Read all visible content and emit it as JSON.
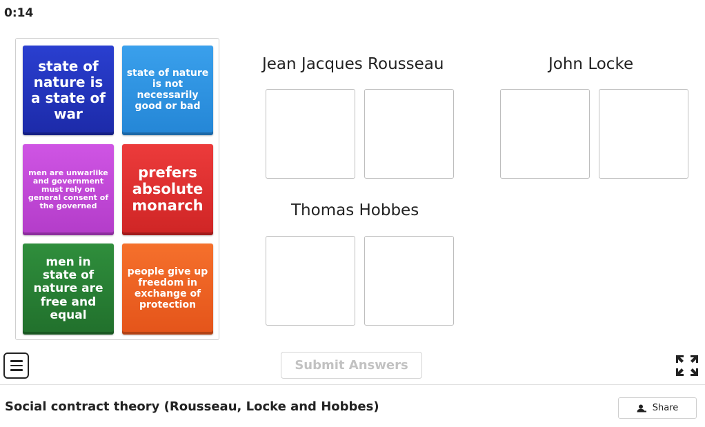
{
  "timer": "0:14",
  "tiles": [
    {
      "label": "state of nature is a state of war",
      "color": "#1c2aa8"
    },
    {
      "label": "state of nature is not necessarily good or bad",
      "color": "#2486d6"
    },
    {
      "label": "men are unwarlike and government must rely on general consent of the governed",
      "color": "#b33cc9"
    },
    {
      "label": "prefers absolute monarch",
      "color": "#cf2525"
    },
    {
      "label": "men in state of nature are free and equal",
      "color": "#21702c"
    },
    {
      "label": "people give up freedom in exchange of protection",
      "color": "#e4541a"
    }
  ],
  "groups": [
    {
      "title": "Jean Jacques Rousseau",
      "slots": 2
    },
    {
      "title": "John Locke",
      "slots": 2
    },
    {
      "title": "Thomas Hobbes",
      "slots": 2
    }
  ],
  "toolbar": {
    "menu_icon": "hamburger-menu-icon",
    "submit_label": "Submit Answers",
    "fullscreen_icon": "fullscreen-expand-icon"
  },
  "footer": {
    "title": "Social contract theory (Rousseau, Locke and Hobbes)",
    "share_label": "Share",
    "share_icon": "person-icon"
  }
}
